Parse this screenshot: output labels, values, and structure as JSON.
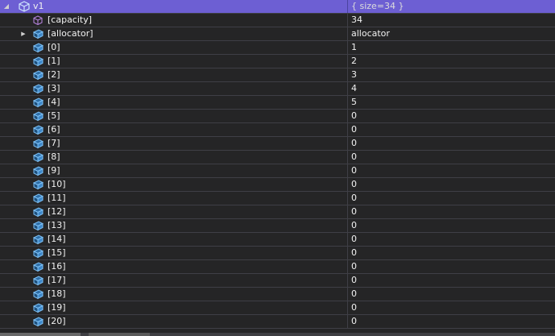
{
  "watch": {
    "root": {
      "name": "v1",
      "value": "{ size=34 }",
      "expanded": true,
      "icon": "cube-variable-icon"
    },
    "children": [
      {
        "name": "[capacity]",
        "value": "34",
        "icon": "purple-box-icon",
        "expandable": false
      },
      {
        "name": "[allocator]",
        "value": "allocator",
        "icon": "blue-cube-icon",
        "expandable": true
      },
      {
        "name": "[0]",
        "value": "1",
        "icon": "blue-cube-icon"
      },
      {
        "name": "[1]",
        "value": "2",
        "icon": "blue-cube-icon"
      },
      {
        "name": "[2]",
        "value": "3",
        "icon": "blue-cube-icon"
      },
      {
        "name": "[3]",
        "value": "4",
        "icon": "blue-cube-icon"
      },
      {
        "name": "[4]",
        "value": "5",
        "icon": "blue-cube-icon"
      },
      {
        "name": "[5]",
        "value": "0",
        "icon": "blue-cube-icon"
      },
      {
        "name": "[6]",
        "value": "0",
        "icon": "blue-cube-icon"
      },
      {
        "name": "[7]",
        "value": "0",
        "icon": "blue-cube-icon"
      },
      {
        "name": "[8]",
        "value": "0",
        "icon": "blue-cube-icon"
      },
      {
        "name": "[9]",
        "value": "0",
        "icon": "blue-cube-icon"
      },
      {
        "name": "[10]",
        "value": "0",
        "icon": "blue-cube-icon"
      },
      {
        "name": "[11]",
        "value": "0",
        "icon": "blue-cube-icon"
      },
      {
        "name": "[12]",
        "value": "0",
        "icon": "blue-cube-icon"
      },
      {
        "name": "[13]",
        "value": "0",
        "icon": "blue-cube-icon"
      },
      {
        "name": "[14]",
        "value": "0",
        "icon": "blue-cube-icon"
      },
      {
        "name": "[15]",
        "value": "0",
        "icon": "blue-cube-icon"
      },
      {
        "name": "[16]",
        "value": "0",
        "icon": "blue-cube-icon"
      },
      {
        "name": "[17]",
        "value": "0",
        "icon": "blue-cube-icon"
      },
      {
        "name": "[18]",
        "value": "0",
        "icon": "blue-cube-icon"
      },
      {
        "name": "[19]",
        "value": "0",
        "icon": "blue-cube-icon"
      },
      {
        "name": "[20]",
        "value": "0",
        "icon": "blue-cube-icon"
      }
    ]
  },
  "colors": {
    "background": "#252526",
    "selected_row": "#6d5fd3",
    "grid_line": "#3f3f46",
    "text": "#f1f1f1",
    "blue_icon": "#5aa5e6",
    "purple_icon": "#b180d7"
  }
}
